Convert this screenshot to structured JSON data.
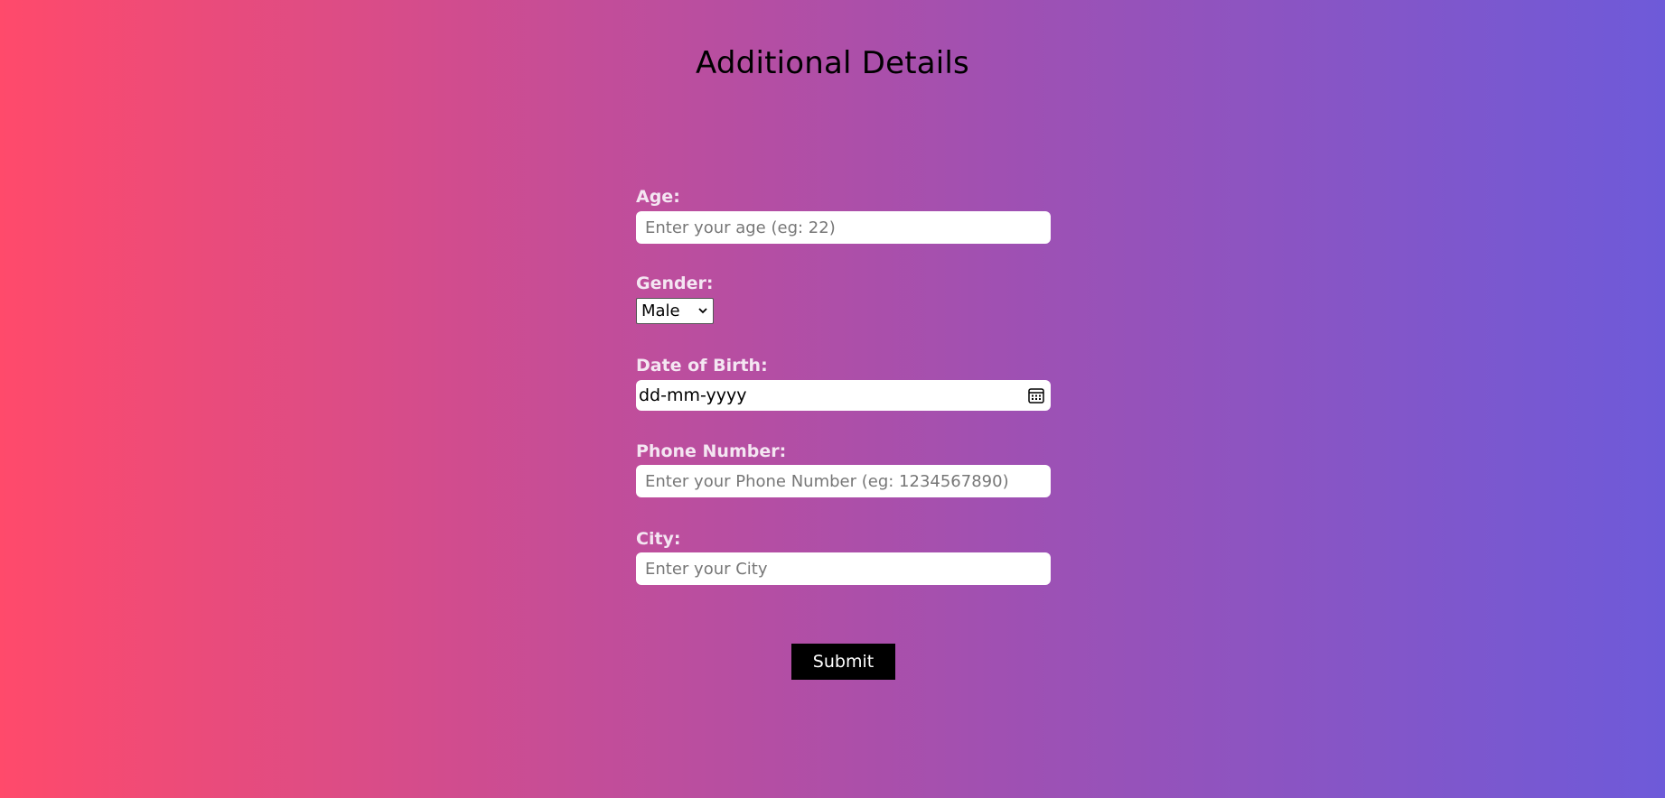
{
  "page": {
    "title": "Additional Details"
  },
  "form": {
    "age": {
      "label": "Age:",
      "placeholder": "Enter your age (eg: 22)",
      "value": ""
    },
    "gender": {
      "label": "Gender:",
      "selected": "Male"
    },
    "dob": {
      "label": "Date of Birth:",
      "value": "dd-mm-yyyy"
    },
    "phone": {
      "label": "Phone Number:",
      "placeholder": "Enter your Phone Number (eg: 1234567890)",
      "value": ""
    },
    "city": {
      "label": "City:",
      "placeholder": "Enter your City",
      "value": ""
    },
    "submit_label": "Submit"
  },
  "icons": {
    "select_arrow": "chevron-down-icon",
    "date_picker": "calendar-icon"
  },
  "colors": {
    "gradient_start": "#ff4a6b",
    "gradient_end": "#6e5ad9",
    "label_text": "#f4e6f2",
    "submit_bg": "#000000",
    "submit_text": "#ffffff"
  }
}
